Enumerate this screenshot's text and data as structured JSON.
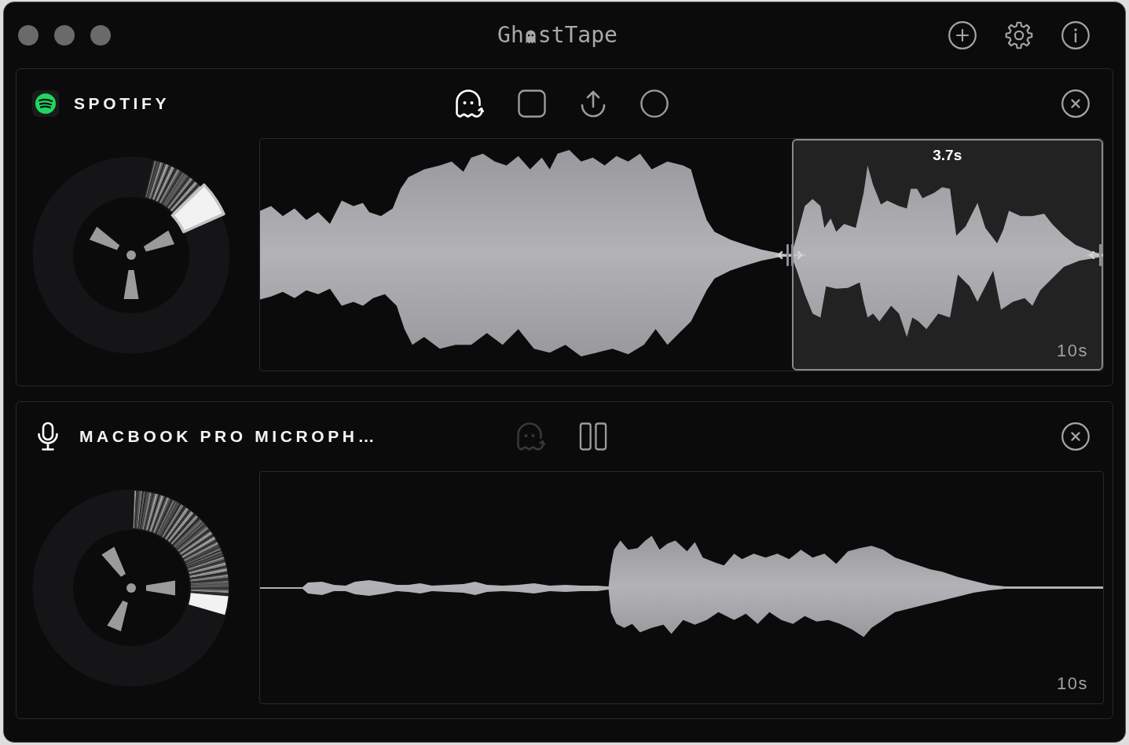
{
  "window": {
    "title_before_icon": "Gh",
    "title_after_icon": "stTape"
  },
  "titlebar_buttons": [
    {
      "kind": "add"
    },
    {
      "kind": "settings"
    },
    {
      "kind": "info"
    }
  ],
  "sources": [
    {
      "kind": "app",
      "name": "SPOTIFY",
      "tools": [
        {
          "kind": "ghost",
          "active": true,
          "disabled": false
        },
        {
          "kind": "stop",
          "active": false,
          "disabled": false
        },
        {
          "kind": "export",
          "active": false,
          "disabled": false
        },
        {
          "kind": "record",
          "active": false,
          "disabled": false
        }
      ],
      "selection": {
        "label": "3.7s"
      },
      "duration": "10s"
    },
    {
      "kind": "microphone",
      "name": "MACBOOK PRO MICROPH…",
      "tools": [
        {
          "kind": "ghost",
          "active": false,
          "disabled": true
        },
        {
          "kind": "pause",
          "active": false,
          "disabled": false
        }
      ],
      "duration": "10s"
    }
  ]
}
